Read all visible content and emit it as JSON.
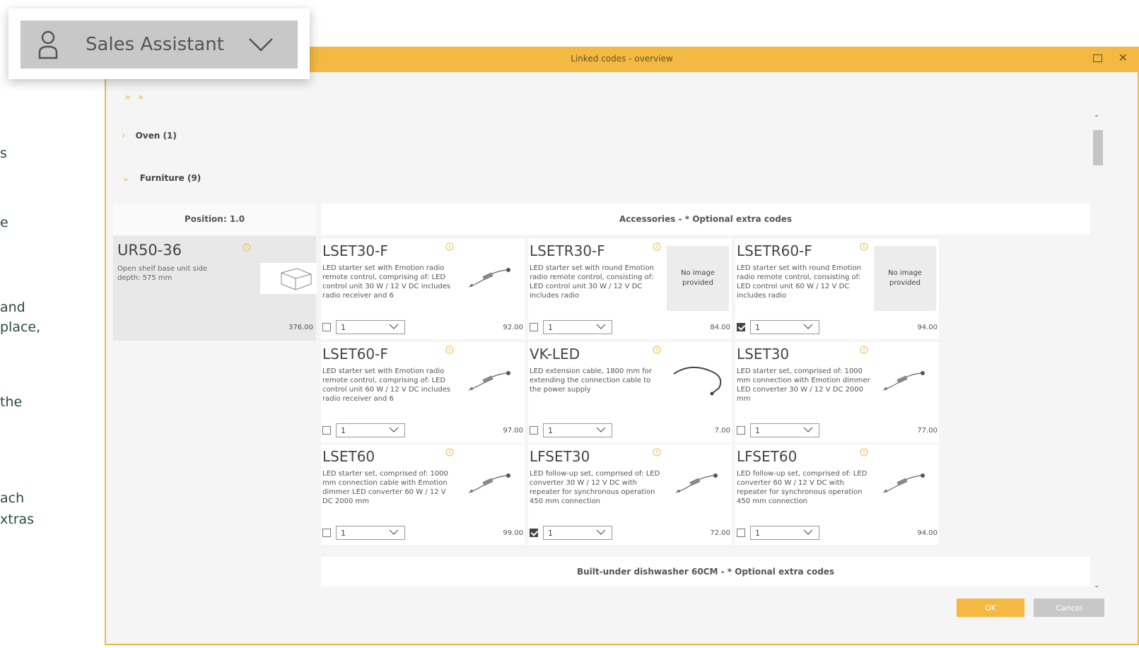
{
  "sidebar_fragments": [
    "s",
    "e",
    "and",
    "place,",
    "the",
    "ach",
    "xtras"
  ],
  "sales_assistant": {
    "label": "Sales Assistant",
    "icon": "person-icon",
    "dropdown_icon": "chevron-down-icon"
  },
  "dialog": {
    "title": "Linked codes - overview",
    "maximize_icon": "maximize-icon",
    "close_icon": "close-icon"
  },
  "toolbar": {
    "collapse_icon": "collapse-all-icon",
    "expand_icon": "expand-all-icon"
  },
  "sections": [
    {
      "label": "Oven (1)",
      "expanded": false
    },
    {
      "label": "Furniture (9)",
      "expanded": true
    }
  ],
  "position": {
    "header": "Position: 1.0",
    "code": "UR50-36",
    "description": "Open shelf base unit side depth: 575 mm",
    "price": "376.00"
  },
  "accessories_header": "Accessories - * Optional extra codes",
  "products": [
    {
      "code": "LSET30-F",
      "description": "LED starter set with Emotion radio remote control, comprising of: LED control unit 30 W / 12 V DC includes radio receiver and 6",
      "image": "led-set",
      "no_image_text": "",
      "checked": false,
      "qty": "1",
      "price": "92.00"
    },
    {
      "code": "LSETR30-F",
      "description": "LED starter set with round Emotion radio remote control, consisting of: LED control unit 30 W / 12 V DC includes radio",
      "image": "none",
      "no_image_text": "No image provided",
      "checked": false,
      "qty": "1",
      "price": "84.00"
    },
    {
      "code": "LSETR60-F",
      "description": "LED starter set with round Emotion radio remote control, consisting of: LED control unit 60 W / 12 V DC includes radio",
      "image": "none",
      "no_image_text": "No image provided",
      "checked": true,
      "qty": "1",
      "price": "94.00"
    },
    {
      "code": "LSET60-F",
      "description": "LED starter set with Emotion radio remote control, comprising of: LED control unit 60 W / 12 V DC includes radio receiver and 6",
      "image": "led-set",
      "no_image_text": "",
      "checked": false,
      "qty": "1",
      "price": "97.00"
    },
    {
      "code": "VK-LED",
      "description": "LED extension cable, 1800 mm for extending the connection cable to the power supply",
      "image": "cable",
      "no_image_text": "",
      "checked": false,
      "qty": "1",
      "price": "7.00"
    },
    {
      "code": "LSET30",
      "description": "LED starter set, comprised of: 1000 mm connection with Emotion dimmer LED converter 30 W / 12 V DC 2000 mm",
      "image": "led-set",
      "no_image_text": "",
      "checked": false,
      "qty": "1",
      "price": "77.00"
    },
    {
      "code": "LSET60",
      "description": "LED starter set, comprised of: 1000 mm connection cable with Emotion dimmer LED converter 60 W / 12 V DC 2000 mm",
      "image": "led-set",
      "no_image_text": "",
      "checked": false,
      "qty": "1",
      "price": "99.00"
    },
    {
      "code": "LFSET30",
      "description": "LED follow-up set, comprised of: LED converter 30 W / 12 V DC with repeater for synchronous operation 450 mm connection",
      "image": "led-set",
      "no_image_text": "",
      "checked": true,
      "qty": "1",
      "price": "72.00"
    },
    {
      "code": "LFSET60",
      "description": "LED follow-up set, comprised of: LED converter 60 W / 12 V DC with repeater for synchronous operation 450 mm connection",
      "image": "led-set",
      "no_image_text": "",
      "checked": false,
      "qty": "1",
      "price": "94.00"
    }
  ],
  "dishwasher_header": "Built-under dishwasher 60CM - * Optional extra codes",
  "buttons": {
    "ok": "OK",
    "cancel": "Cancel"
  },
  "colors": {
    "accent": "#f4b942",
    "panel": "#f5f5f5",
    "card_selected": "#e8e8e8"
  }
}
